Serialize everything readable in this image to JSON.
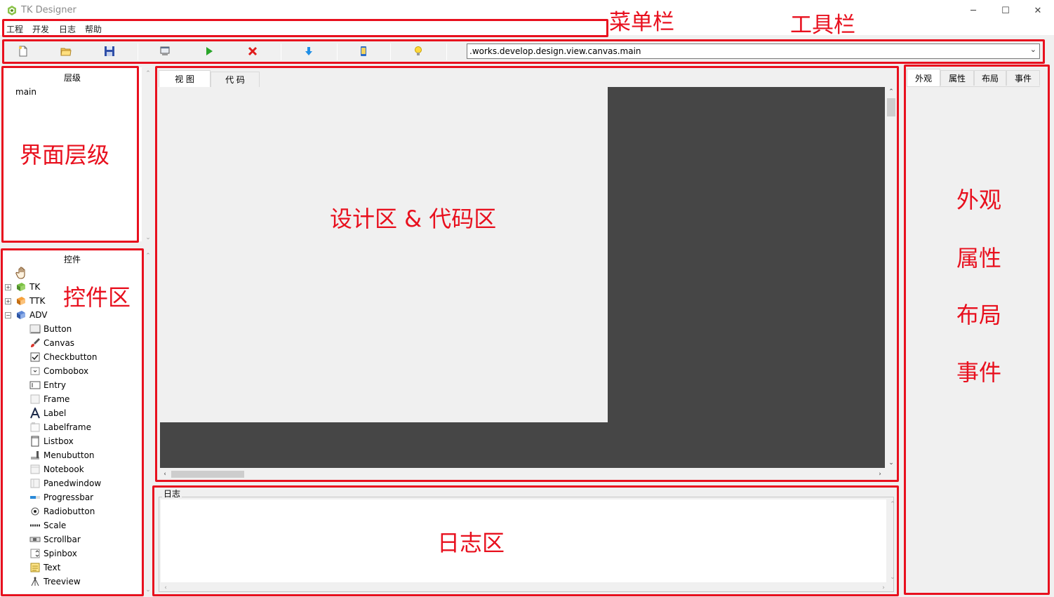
{
  "window": {
    "title": "TK Designer",
    "minimize_icon": "─",
    "maximize_icon": "☐",
    "close_icon": "✕"
  },
  "menu": [
    "工程",
    "开发",
    "日志",
    "帮助"
  ],
  "toolbar": {
    "buttons": [
      "new-file",
      "open-folder",
      "save",
      "preview",
      "run",
      "stop",
      "download",
      "device",
      "idea"
    ],
    "path_value": ".works.develop.design.view.canvas.main"
  },
  "hierarchy": {
    "title": "层级",
    "root": "main"
  },
  "widgets": {
    "title": "控件",
    "groups": [
      "TK",
      "TTK",
      "ADV"
    ],
    "items": [
      "Button",
      "Canvas",
      "Checkbutton",
      "Combobox",
      "Entry",
      "Frame",
      "Label",
      "Labelframe",
      "Listbox",
      "Menubutton",
      "Notebook",
      "Panedwindow",
      "Progressbar",
      "Radiobutton",
      "Scale",
      "Scrollbar",
      "Spinbox",
      "Text",
      "Treeview"
    ]
  },
  "editor": {
    "tabs": [
      "视 图",
      "代 码"
    ]
  },
  "log": {
    "title": "日志"
  },
  "inspector": {
    "tabs": [
      "外观",
      "属性",
      "布局",
      "事件"
    ]
  },
  "annotations": {
    "menubar": "菜单栏",
    "toolbar": "工具栏",
    "hierarchy": "界面层级",
    "widgets": "控件区",
    "design": "设计区 & 代码区",
    "log": "日志区",
    "inspector_lines": [
      "外观",
      "属性",
      "布局",
      "事件"
    ]
  },
  "colors": {
    "annotation_red": "#e8101e",
    "canvas_dark": "#464646",
    "canvas_light": "#f0f0f0"
  }
}
